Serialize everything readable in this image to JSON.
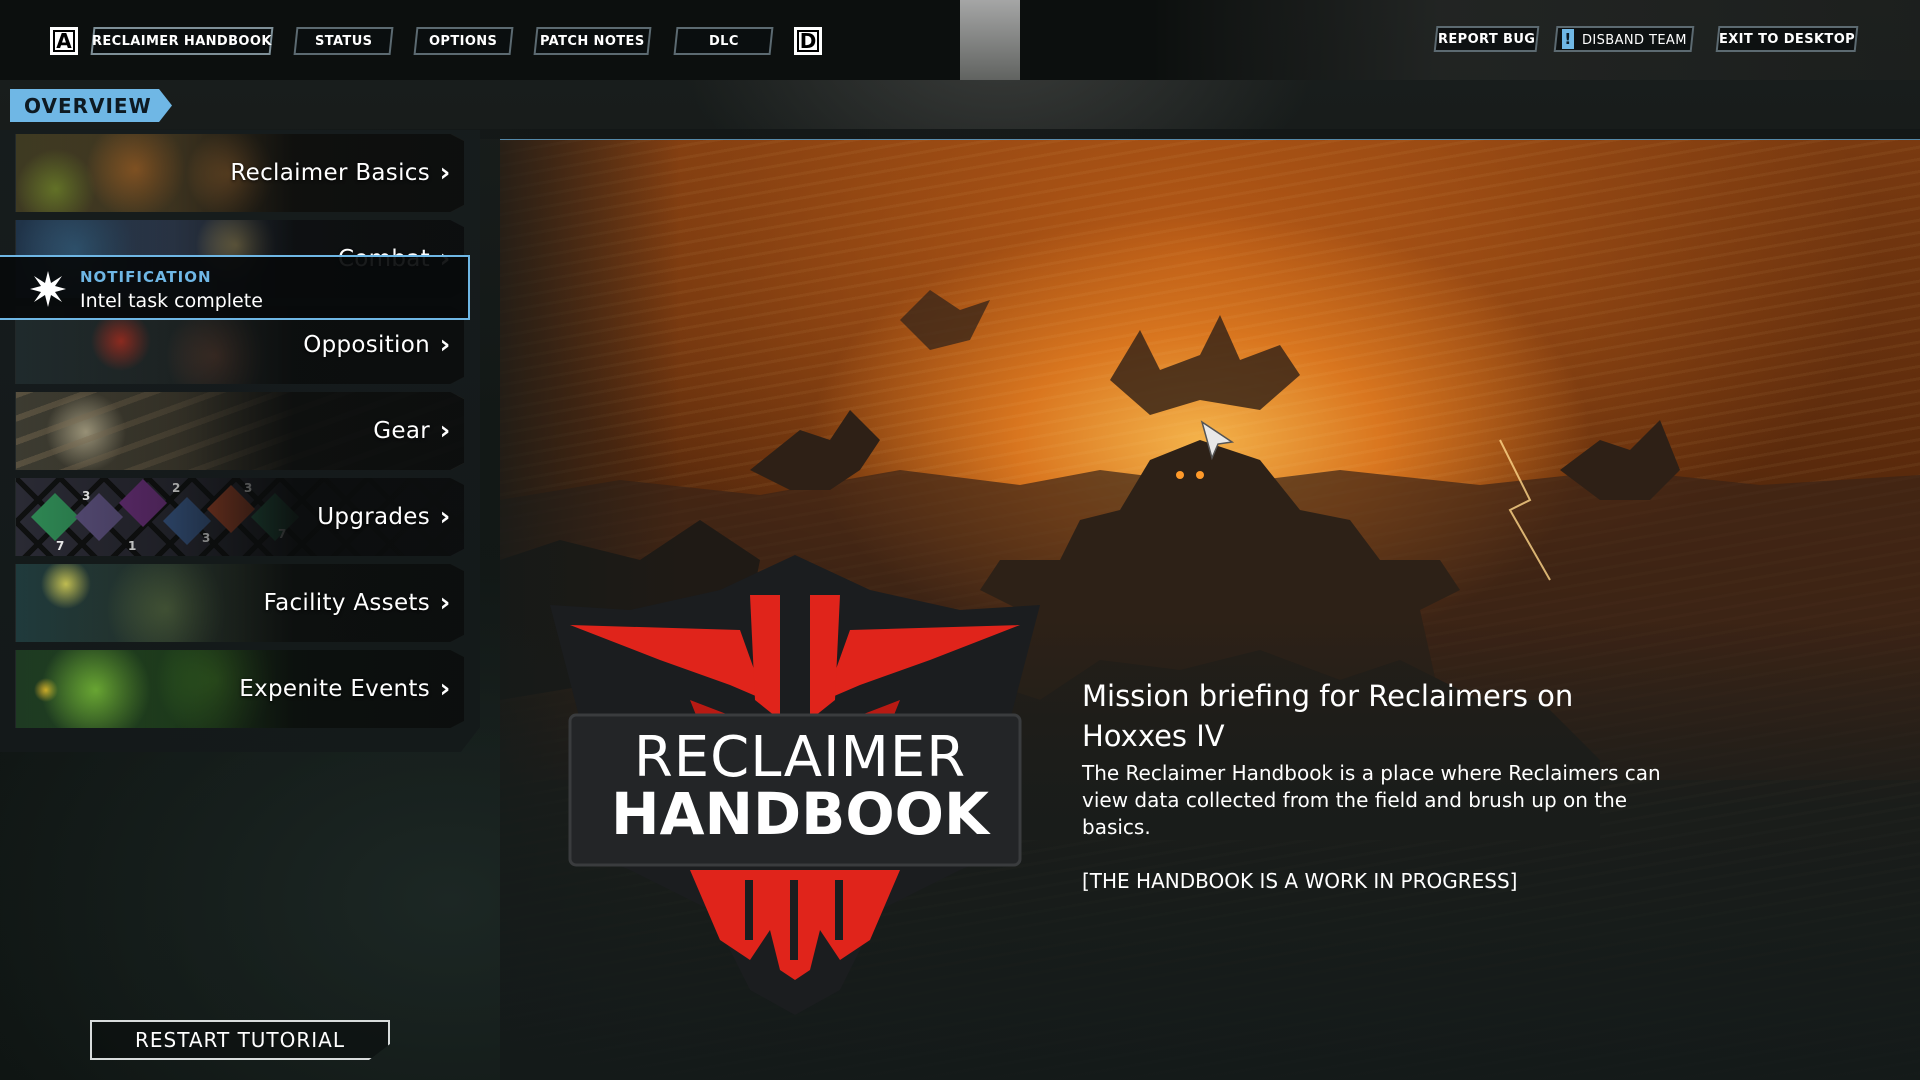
{
  "topbar": {
    "left_key": "A",
    "right_key": "D",
    "tabs": [
      {
        "label": "RECLAIMER HANDBOOK"
      },
      {
        "label": "STATUS"
      },
      {
        "label": "OPTIONS"
      },
      {
        "label": "PATCH NOTES"
      },
      {
        "label": "DLC"
      }
    ],
    "actions": [
      {
        "label": "REPORT BUG"
      },
      {
        "label": "DISBAND TEAM",
        "icon_text": "!"
      },
      {
        "label": "EXIT TO DESKTOP"
      }
    ]
  },
  "section_label": "OVERVIEW",
  "menu": {
    "items": [
      {
        "label": "Reclaimer Basics",
        "chevron": "›"
      },
      {
        "label": "Combat",
        "chevron": "›"
      },
      {
        "label": "Opposition",
        "chevron": "›"
      },
      {
        "label": "Gear",
        "chevron": "›"
      },
      {
        "label": "Upgrades",
        "chevron": "›"
      },
      {
        "label": "Facility Assets",
        "chevron": "›"
      },
      {
        "label": "Expenite Events",
        "chevron": "›"
      }
    ]
  },
  "upgrade_tile_numbers": [
    "3",
    "2",
    "3",
    "7",
    "1",
    "3",
    "7"
  ],
  "notification": {
    "title": "NOTIFICATION",
    "text": "Intel task complete",
    "icon": "starburst-icon"
  },
  "logo": {
    "line1": "RECLAIMER",
    "line2": "HANDBOOK"
  },
  "briefing": {
    "title": "Mission briefing for Reclaimers on Hoxxes IV",
    "body": "The Reclaimer Handbook is a place where Reclaimers can view data collected from the field and brush up on the basics.",
    "note": "[THE HANDBOOK IS A WORK IN PROGRESS]"
  },
  "restart_button": "RESTART TUTORIAL",
  "colors": {
    "accent": "#6fb7e5",
    "logo_red": "#e0241b",
    "logo_dark": "#1b1d1f"
  }
}
